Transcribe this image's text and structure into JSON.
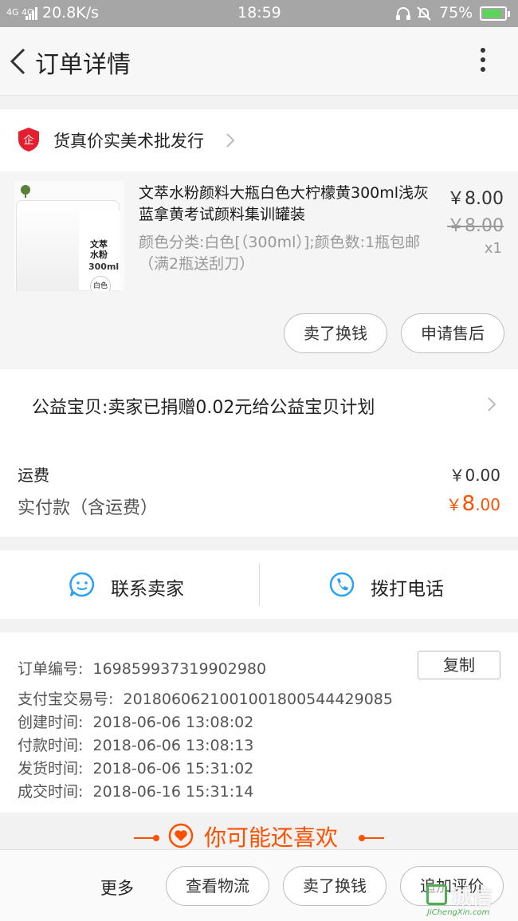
{
  "status_bar": {
    "network": "4G 4G",
    "speed": "20.8K/s",
    "time": "18:59",
    "battery": "75%",
    "battery_color": "#5ad55a"
  },
  "nav": {
    "title": "订单详情",
    "back_icon": "chevron-left-icon",
    "more_icon": "more-vertical-icon"
  },
  "shop": {
    "name": "货真价实美术批发行",
    "logo_icon": "enterprise-shield-icon",
    "logo_color": "#e4202f"
  },
  "item": {
    "title": "文萃水粉颜料大瓶白色大柠檬黄300ml浅灰蓝拿黄考试颜料集训罐装",
    "spec": "颜色分类:白色[（300ml）];颜色数:1瓶包邮（满2瓶送刮刀）",
    "price": "￥8.00",
    "original_price": "￥8.00",
    "quantity": "x1",
    "thumb_label_1": "文萃\n水粉",
    "thumb_label_2": "300ml",
    "thumb_label_3": "白色",
    "buttons": [
      "卖了换钱",
      "申请售后"
    ]
  },
  "charity": {
    "text": "公益宝贝:卖家已捐赠0.02元给公益宝贝计划"
  },
  "fees": {
    "shipping_label": "运费",
    "shipping_value": "￥0.00",
    "paid_label": "实付款（含运费）",
    "paid_currency": "￥",
    "paid_int": "8",
    "paid_dec": ".00",
    "accent": "#ff5000"
  },
  "contact": {
    "seller_label": "联系卖家",
    "phone_label": "拨打电话",
    "icon_color": "#29a1f7"
  },
  "order_info": {
    "copy_label": "复制",
    "rows": [
      {
        "label": "订单编号:",
        "value": "169859937319902980"
      },
      {
        "label": "支付宝交易号:",
        "value": "2018060621001001800544429085"
      },
      {
        "label": "创建时间:",
        "value": "2018-06-06 13:08:02"
      },
      {
        "label": "付款时间:",
        "value": "2018-06-06 13:08:13"
      },
      {
        "label": "发货时间:",
        "value": "2018-06-06 15:31:02"
      },
      {
        "label": "成交时间:",
        "value": "2018-06-16 15:31:14"
      }
    ]
  },
  "recommend": {
    "title": "你可能还喜欢"
  },
  "bottom_bar": {
    "more": "更多",
    "buttons": [
      "查看物流",
      "卖了换钱",
      "追加评价"
    ]
  },
  "watermark": {
    "cn": "城信",
    "en": "JiChengXin.com"
  }
}
